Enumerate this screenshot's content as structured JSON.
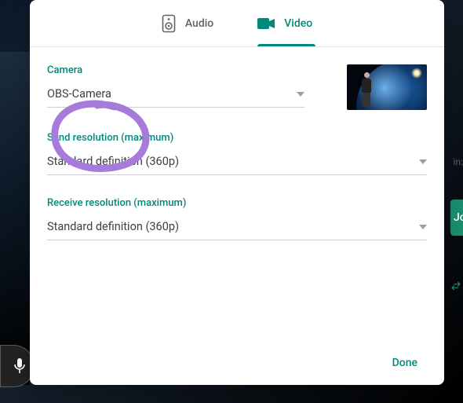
{
  "tabs": {
    "audio": "Audio",
    "video": "Video"
  },
  "camera": {
    "label": "Camera",
    "value": "OBS-Camera"
  },
  "send": {
    "label": "Send resolution (maximum)",
    "value": "Standard definition (360p)"
  },
  "receive": {
    "label": "Receive resolution (maximum)",
    "value": "Standard definition (360p)"
  },
  "footer": {
    "done": "Done"
  },
  "background": {
    "pin_label": "in:",
    "join": "Jo"
  }
}
